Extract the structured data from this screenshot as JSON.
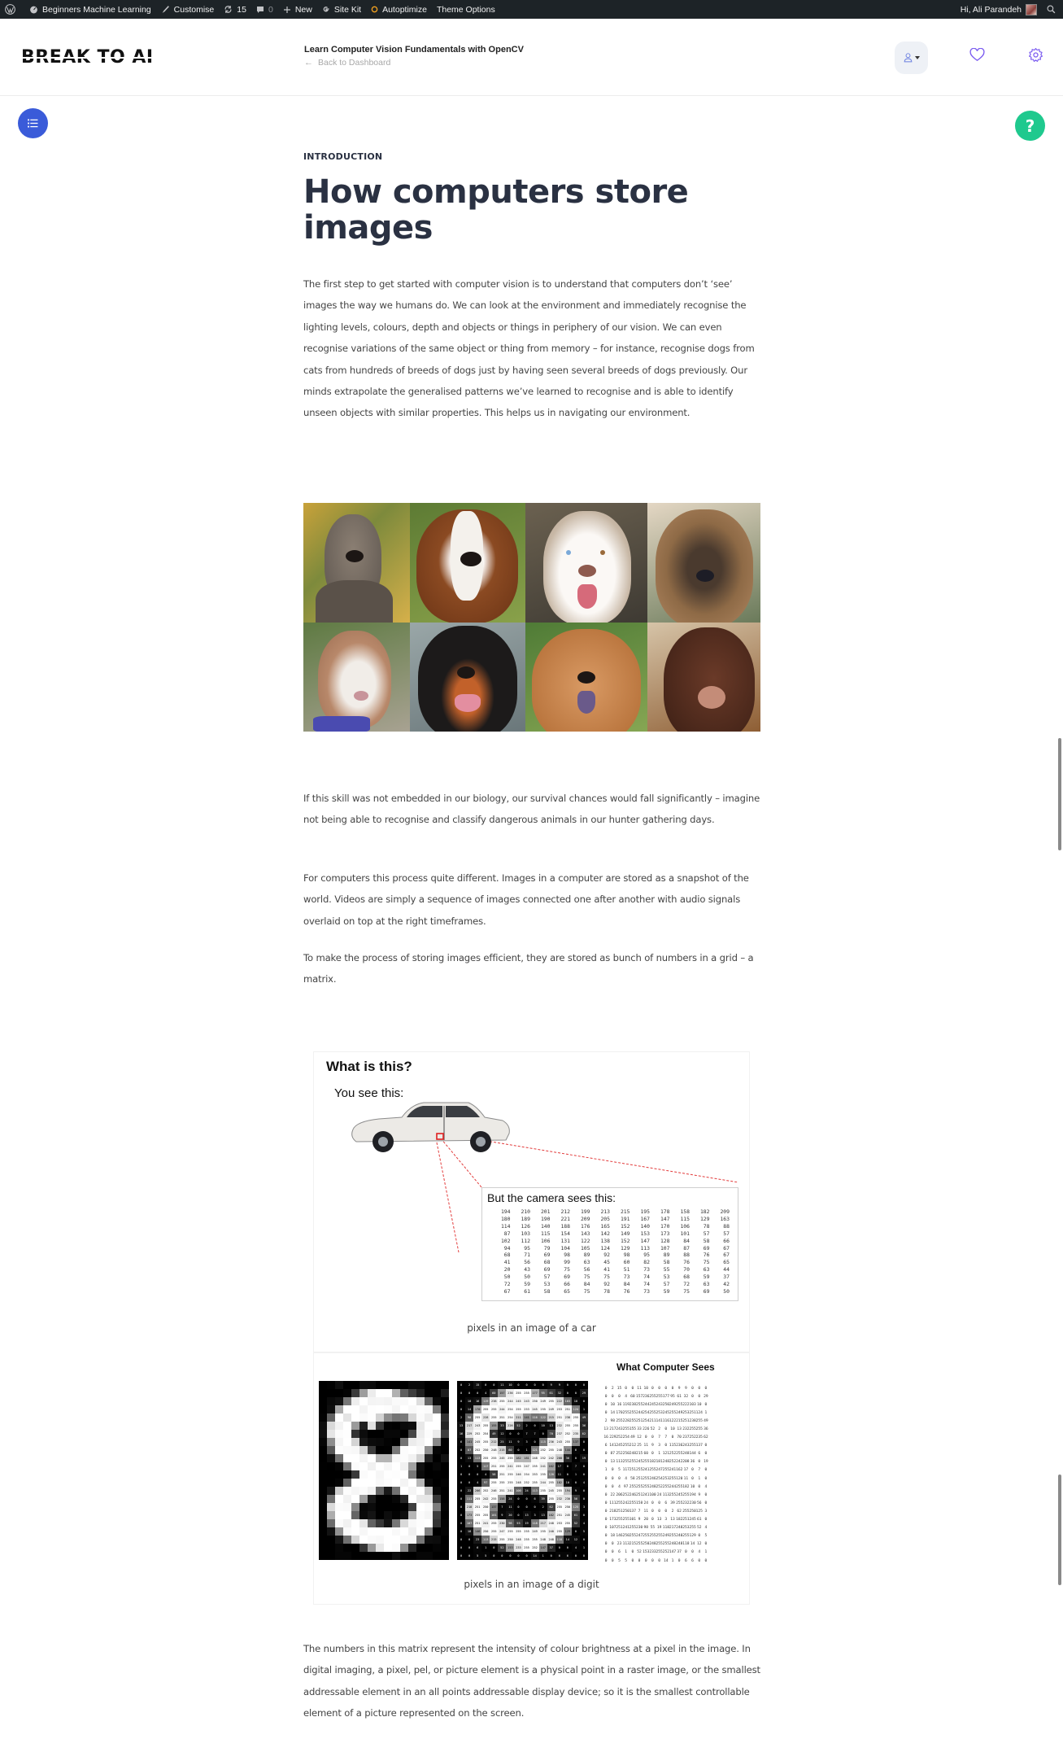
{
  "admin_bar": {
    "items": [
      {
        "icon": "wordpress-icon",
        "label": ""
      },
      {
        "icon": "dashboard-icon",
        "label": "Beginners Machine Learning"
      },
      {
        "icon": "brush-icon",
        "label": "Customise"
      },
      {
        "icon": "updates-icon",
        "label": "15"
      },
      {
        "icon": "comment-icon",
        "label": "0"
      },
      {
        "icon": "plus-icon",
        "label": "New"
      },
      {
        "icon": "google-icon",
        "label": "Site Kit"
      },
      {
        "icon": "autoptimize-icon",
        "label": "Autoptimize"
      },
      {
        "icon": "",
        "label": "Theme Options"
      }
    ],
    "greeting": "Hi, Ali Parandeh",
    "search_icon": "search-icon"
  },
  "header": {
    "logo": "BREAK TO AI",
    "course_title": "Learn Computer Vision Fundamentals with OpenCV",
    "back_link": "Back to Dashboard",
    "icons": [
      "user-icon",
      "heart-icon",
      "gear-icon"
    ]
  },
  "floating": {
    "toc_icon": "list-icon",
    "help_label": "?"
  },
  "colors": {
    "accent_blue": "#3a5bd9",
    "help_green": "#1fc98e",
    "title": "#2a3142",
    "icon_purple": "#7b5cf0",
    "admin_bar": "#1d2327"
  },
  "article": {
    "eyebrow": "INTRODUCTION",
    "title": "How computers store images",
    "paragraphs": [
      "The first step to get started with computer vision is to understand that computers don’t ‘see’ images the way we humans do. We can look at the environment and immediately recognise the lighting levels, colours, depth and objects or things in periphery of our vision. We can even recognise variations of the same object or thing from memory – for instance, recognise dogs from cats from hundreds of breeds of dogs just by having seen several breeds of dogs previously. Our minds extrapolate the generalised patterns we’ve learned to recognise and is able to identify unseen objects with similar properties. This helps us in navigating our environment.",
      "If this skill was not embedded in our biology, our survival chances would fall significantly – imagine not being able to recognise and classify dangerous animals in our hunter gathering days.",
      "For computers this process quite different. Images in a computer are stored as a snapshot of the world. Videos are simply a sequence of images connected one after another with audio signals overlaid on top at the right timeframes.",
      "To make the process of storing images efficient, they are stored as bunch of numbers in a grid – a matrix.",
      "The numbers in this matrix represent the intensity of colour brightness at a pixel in the image. In digital imaging, a pixel, pel, or picture element is a physical point in a raster image, or the smallest addressable element in an all points addressable display device; so it is the smallest controllable element of a picture represented on the screen."
    ],
    "dog_grid": [
      "great-dane",
      "saint-bernard",
      "husky",
      "german-shepherd",
      "pit-bull",
      "rottweiler",
      "chow-chow",
      "doberman"
    ],
    "figure_car": {
      "heading": "What is this?",
      "subheading": "You see this:",
      "camera_title": "But the camera sees this:",
      "caption": "pixels in an image of a car",
      "matrix": [
        [
          194,
          210,
          201,
          212,
          199,
          213,
          215,
          195,
          178,
          158,
          182,
          209
        ],
        [
          180,
          189,
          190,
          221,
          209,
          205,
          191,
          167,
          147,
          115,
          129,
          163
        ],
        [
          114,
          126,
          140,
          188,
          176,
          165,
          152,
          140,
          170,
          106,
          78,
          88
        ],
        [
          87,
          103,
          115,
          154,
          143,
          142,
          149,
          153,
          173,
          101,
          57,
          57
        ],
        [
          102,
          112,
          106,
          131,
          122,
          138,
          152,
          147,
          128,
          84,
          58,
          66
        ],
        [
          94,
          95,
          79,
          104,
          105,
          124,
          129,
          113,
          107,
          87,
          69,
          67
        ],
        [
          68,
          71,
          69,
          98,
          89,
          92,
          98,
          95,
          89,
          88,
          76,
          67
        ],
        [
          41,
          56,
          68,
          99,
          63,
          45,
          60,
          82,
          58,
          76,
          75,
          65
        ],
        [
          20,
          43,
          69,
          75,
          56,
          41,
          51,
          73,
          55,
          70,
          63,
          44
        ],
        [
          50,
          50,
          57,
          69,
          75,
          75,
          73,
          74,
          53,
          68,
          59,
          37
        ],
        [
          72,
          59,
          53,
          66,
          84,
          92,
          84,
          74,
          57,
          72,
          63,
          42
        ],
        [
          67,
          61,
          58,
          65,
          75,
          78,
          76,
          73,
          59,
          75,
          69,
          50
        ]
      ]
    },
    "figure_digit": {
      "heading": "What Computer Sees",
      "caption": "pixels in an image of a digit",
      "matrix": [
        [
          0,
          2,
          15,
          0,
          0,
          11,
          10,
          0,
          0,
          0,
          0,
          9,
          9,
          0,
          0,
          0
        ],
        [
          0,
          0,
          0,
          4,
          60,
          157,
          236,
          255,
          255,
          177,
          95,
          61,
          32,
          0,
          0,
          29
        ],
        [
          0,
          10,
          16,
          119,
          238,
          255,
          244,
          245,
          243,
          250,
          249,
          255,
          222,
          103,
          10,
          0
        ],
        [
          0,
          14,
          170,
          255,
          255,
          244,
          254,
          255,
          253,
          245,
          255,
          249,
          253,
          251,
          124,
          1
        ],
        [
          2,
          98,
          255,
          228,
          255,
          251,
          254,
          211,
          141,
          116,
          122,
          215,
          251,
          238,
          255,
          49
        ],
        [
          13,
          217,
          243,
          255,
          155,
          33,
          226,
          52,
          2,
          0,
          10,
          13,
          232,
          255,
          255,
          36
        ],
        [
          16,
          229,
          252,
          254,
          49,
          12,
          0,
          0,
          7,
          7,
          0,
          70,
          237,
          252,
          235,
          62
        ],
        [
          6,
          141,
          245,
          255,
          212,
          25,
          11,
          9,
          3,
          0,
          115,
          236,
          243,
          255,
          137,
          0
        ],
        [
          0,
          87,
          252,
          250,
          248,
          215,
          60,
          0,
          1,
          121,
          252,
          255,
          248,
          144,
          6,
          0
        ],
        [
          0,
          13,
          113,
          255,
          255,
          245,
          255,
          182,
          181,
          248,
          252,
          242,
          208,
          36,
          0,
          19
        ],
        [
          1,
          0,
          5,
          117,
          251,
          255,
          241,
          255,
          247,
          255,
          241,
          162,
          17,
          0,
          7,
          0
        ],
        [
          0,
          0,
          0,
          4,
          58,
          251,
          255,
          246,
          254,
          253,
          255,
          120,
          11,
          0,
          1,
          0
        ],
        [
          0,
          0,
          4,
          97,
          255,
          255,
          255,
          248,
          252,
          255,
          244,
          255,
          182,
          10,
          0,
          4
        ],
        [
          0,
          22,
          206,
          252,
          246,
          251,
          241,
          100,
          24,
          113,
          255,
          245,
          255,
          194,
          9,
          0
        ],
        [
          0,
          111,
          255,
          242,
          255,
          158,
          24,
          0,
          0,
          6,
          39,
          255,
          232,
          230,
          56,
          0
        ],
        [
          0,
          218,
          251,
          250,
          137,
          7,
          11,
          0,
          0,
          0,
          2,
          62,
          255,
          250,
          125,
          3
        ],
        [
          0,
          173,
          255,
          255,
          101,
          9,
          20,
          0,
          13,
          3,
          13,
          182,
          251,
          245,
          61,
          0
        ],
        [
          0,
          107,
          251,
          241,
          255,
          230,
          98,
          55,
          19,
          118,
          217,
          248,
          253,
          255,
          52,
          4
        ],
        [
          0,
          18,
          146,
          250,
          255,
          247,
          255,
          255,
          255,
          249,
          255,
          240,
          255,
          129,
          0,
          5
        ],
        [
          0,
          0,
          23,
          113,
          215,
          255,
          250,
          248,
          255,
          255,
          248,
          248,
          118,
          14,
          12,
          0
        ],
        [
          0,
          0,
          6,
          1,
          0,
          52,
          153,
          233,
          255,
          252,
          147,
          37,
          0,
          0,
          4,
          1
        ],
        [
          0,
          0,
          5,
          5,
          0,
          0,
          0,
          0,
          0,
          14,
          1,
          0,
          6,
          6,
          0,
          0
        ]
      ]
    }
  }
}
